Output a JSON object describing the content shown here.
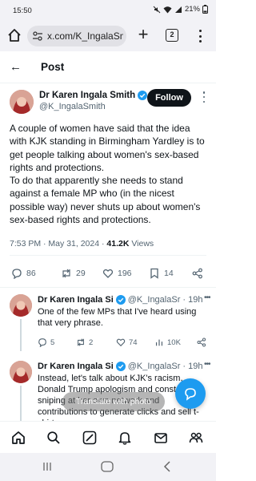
{
  "status_bar": {
    "time": "15:50",
    "battery": "21%"
  },
  "browser": {
    "url": "x.com/K_IngalaSm",
    "tab_count": "2"
  },
  "header": {
    "title": "Post"
  },
  "post": {
    "author_name": "Dr Karen Ingala Smith",
    "author_handle": "@K_IngalaSmith",
    "follow_label": "Follow",
    "body_line1": "A couple of women have said that the idea with KJK standing in Birmingham Yardley is to get people talking about women's sex-based rights and protections.",
    "body_line2": "To do that apparently she needs to stand against a female MP who (in the nicest possible way) never shuts up about women's sex-based rights and protections.",
    "meta_time": "7:53 PM · May 31, 2024 · ",
    "meta_views_count": "41.2K",
    "meta_views_label": " Views",
    "stats": {
      "replies": "86",
      "reposts": "29",
      "likes": "196",
      "bookmarks": "14"
    }
  },
  "replies": [
    {
      "author_name": "Dr Karen Ingala Si",
      "handle_time": "@K_IngalaSr · 19h",
      "text": "One of the few MPs that I've heard using that very phrase.",
      "stats": {
        "replies": "5",
        "reposts": "2",
        "likes": "74",
        "views": "10K"
      }
    },
    {
      "author_name": "Dr Karen Ingala Si",
      "handle_time": "@K_IngalaSr · 19h",
      "text": "Instead, let's talk about KJK's racism, Donald Trump apologism and constant sniping at her own network and contributions to generate clicks and sell t-shirts."
    }
  ],
  "overlay": {
    "label": "Translate with photo"
  },
  "colors": {
    "accent": "#1d9bf0",
    "text": "#0f1419",
    "muted": "#536471"
  }
}
